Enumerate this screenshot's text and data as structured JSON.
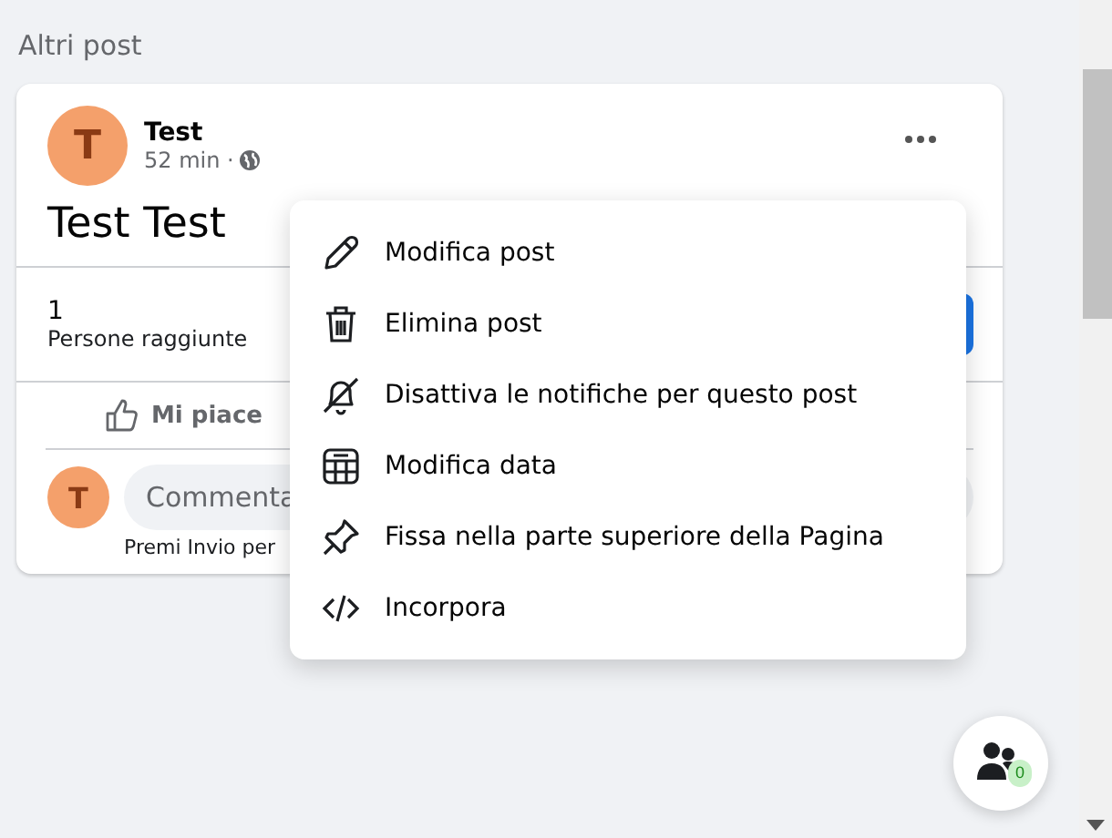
{
  "section_title": "Altri post",
  "post": {
    "avatar_letter": "T",
    "author": "Test",
    "time": "52 min ·",
    "text": "Test Test",
    "reach_count": "1",
    "reach_label": "Persone raggiunte",
    "like_label": "Mi piace",
    "comment_avatar_letter": "T",
    "comment_placeholder": "Commenta",
    "comment_hint": "Premi Invio per"
  },
  "menu": {
    "items": [
      {
        "kind": "edit",
        "label": "Modifica post"
      },
      {
        "kind": "delete",
        "label": "Elimina post"
      },
      {
        "kind": "mute",
        "label": "Disattiva le notifiche per questo post"
      },
      {
        "kind": "date",
        "label": "Modifica data"
      },
      {
        "kind": "pin",
        "label": "Fissa nella parte superiore della Pagina"
      },
      {
        "kind": "embed",
        "label": "Incorpora"
      }
    ]
  },
  "contacts_button": {
    "badge": "0"
  }
}
